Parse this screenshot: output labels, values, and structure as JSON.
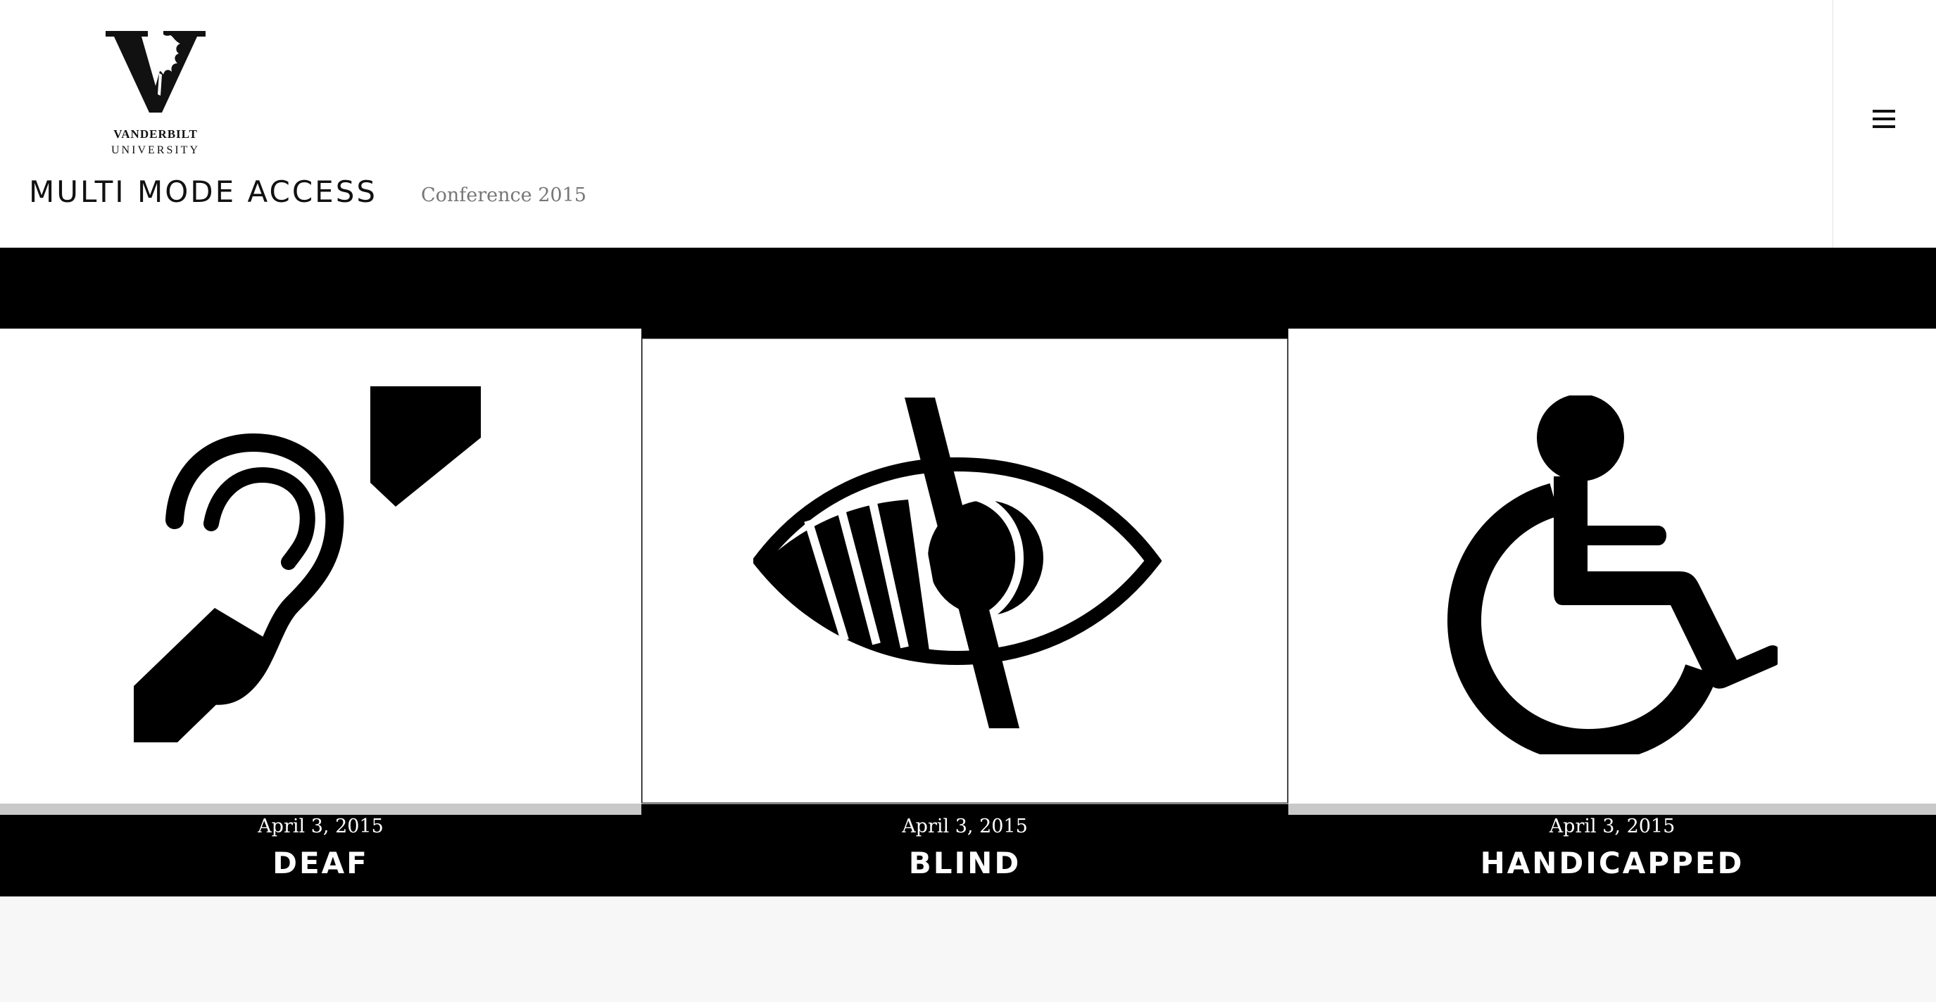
{
  "header": {
    "logo": {
      "line1": "VANDERBILT",
      "line2": "UNIVERSITY"
    },
    "site_title": "MULTI MODE ACCESS",
    "site_description": "Conference 2015",
    "menu_icon": "hamburger-menu-icon"
  },
  "posts": [
    {
      "date": "April 3, 2015",
      "title": "DEAF",
      "icon": "hearing-impaired-icon"
    },
    {
      "date": "April 3, 2015",
      "title": "BLIND",
      "icon": "visually-impaired-icon"
    },
    {
      "date": "April 3, 2015",
      "title": "HANDICAPPED",
      "icon": "wheelchair-icon"
    }
  ],
  "colors": {
    "band": "#000000",
    "header_bg": "#ffffff",
    "page_bg": "#f7f7f7",
    "strip": "#c9c9c9"
  }
}
